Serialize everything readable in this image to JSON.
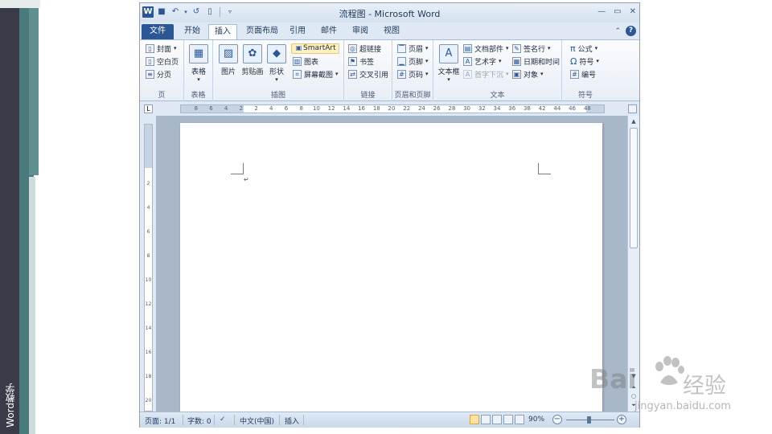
{
  "left_strip": {
    "text": "Word教学"
  },
  "window": {
    "title": "流程图 - Microsoft Word",
    "qat_icons": [
      "word-logo-icon",
      "save-icon",
      "undo-icon",
      "redo-icon",
      "new-doc-icon",
      "customize-icon"
    ],
    "controls": [
      "—",
      "▭",
      "✕"
    ]
  },
  "tabs": [
    "文件",
    "开始",
    "插入",
    "页面布局",
    "引用",
    "邮件",
    "审阅",
    "视图"
  ],
  "active_tab": "插入",
  "ribbon": {
    "pages_group": {
      "label": "页",
      "items": [
        "封面",
        "空白页",
        "分页"
      ]
    },
    "tables_group": {
      "label": "表格",
      "items": [
        "表格"
      ]
    },
    "illustrations_group": {
      "label": "插图",
      "items": [
        "图片",
        "剪贴画",
        "形状",
        "SmartArt",
        "图表",
        "屏幕截图"
      ]
    },
    "links_group": {
      "label": "链接",
      "items": [
        "超链接",
        "书签",
        "交叉引用"
      ]
    },
    "header_footer_group": {
      "label": "页眉和页脚",
      "items": [
        "页眉",
        "页脚",
        "页码"
      ]
    },
    "text_group": {
      "label": "文本",
      "items": [
        "文本框",
        "文档部件",
        "艺术字",
        "首字下沉",
        "签名行",
        "日期和时间",
        "对象"
      ]
    },
    "symbols_group": {
      "label": "符号",
      "items": [
        "公式",
        "符号",
        "编号"
      ]
    }
  },
  "ruler": {
    "ticks": [
      "8",
      "6",
      "4",
      "2",
      "2",
      "4",
      "6",
      "8",
      "10",
      "12",
      "14",
      "16",
      "18",
      "20",
      "22",
      "24",
      "26",
      "28",
      "30",
      "32",
      "34",
      "36",
      "38",
      "42",
      "44",
      "46",
      "48"
    ],
    "vticks": [
      "2",
      "4",
      "6",
      "8",
      "10",
      "12",
      "14",
      "16",
      "18",
      "20"
    ]
  },
  "document": {
    "paragraph_mark": "↵"
  },
  "statusbar": {
    "page": "页面: 1/1",
    "words": "字数: 0",
    "language": "中文(中国)",
    "mode": "插入",
    "zoom": "90%",
    "zoom_value": 90
  },
  "watermark": {
    "logo": "Bai",
    "logo_tail": "经验",
    "url": "jingyan.baidu.com"
  }
}
